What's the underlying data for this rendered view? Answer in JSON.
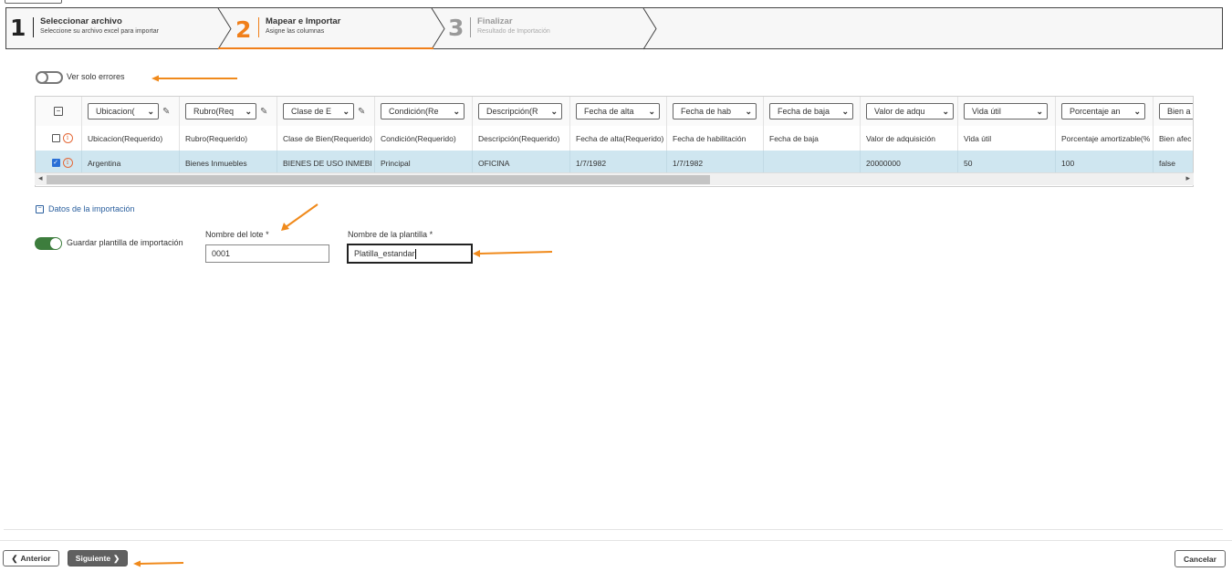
{
  "wizard": {
    "steps": [
      {
        "number": "1",
        "title": "Seleccionar archivo",
        "subtitle": "Seleccione su archivo excel para importar",
        "state": "done"
      },
      {
        "number": "2",
        "title": "Mapear e Importar",
        "subtitle": "Asigne las columnas",
        "state": "active"
      },
      {
        "number": "3",
        "title": "Finalizar",
        "subtitle": "Resultado de Importación",
        "state": "pending"
      }
    ]
  },
  "errors_toggle": {
    "label": "Ver solo errores",
    "on": false
  },
  "grid": {
    "mapping_selects": [
      "Ubicacion(",
      "Rubro(Req",
      "Clase de E",
      "Condición(Re",
      "Descripción(R",
      "Fecha de alta",
      "Fecha de hab",
      "Fecha de baja",
      "Valor de adqu",
      "Vida útil",
      "Porcentaje an",
      "Bien a"
    ],
    "headers": [
      "Ubicacion(Requerido)",
      "Rubro(Requerido)",
      "Clase de Bien(Requerido)",
      "Condición(Requerido)",
      "Descripción(Requerido)",
      "Fecha de alta(Requerido)",
      "Fecha de habilitación",
      "Fecha de baja",
      "Valor de adquisición",
      "Vida útil",
      "Porcentaje amortizable(%",
      "Bien afec"
    ],
    "rows": [
      [
        "Argentina",
        "Bienes Inmuebles",
        "BIENES DE USO INMEBI",
        "Principal",
        "OFICINA",
        "1/7/1982",
        "1/7/1982",
        "",
        "20000000",
        "50",
        "100",
        "false"
      ]
    ],
    "row_checked": [
      true
    ]
  },
  "import_section": {
    "title": "Datos de la importación",
    "save_template_label": "Guardar plantilla de importación",
    "save_template_on": true,
    "lote_label": "Nombre del lote",
    "lote_value": "0001",
    "plantilla_label": "Nombre de la plantilla",
    "plantilla_value": "Platilla_estandar",
    "required_mark": "*"
  },
  "footer": {
    "anterior_label": "Anterior",
    "siguiente_label": "Siguiente",
    "cancelar_label": "Cancelar"
  },
  "colors": {
    "accent": "#f07f1a",
    "row_selected": "#cfe6f0",
    "toggle_on": "#3d7d3d",
    "link": "#2a5f9e"
  }
}
